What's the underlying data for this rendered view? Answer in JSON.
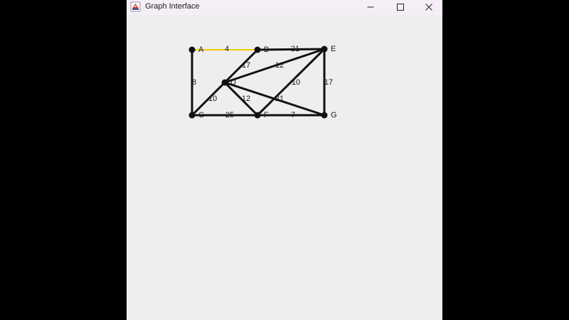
{
  "window": {
    "title": "Graph Interface",
    "icon": "java-cup-icon",
    "controls": [
      "minimize-icon",
      "maximize-icon",
      "close-icon"
    ]
  },
  "colors": {
    "edge": "#111111",
    "highlight": "#f0d000",
    "node": "#111111",
    "background": "#eeedf0",
    "titlebar": "#f6eef7"
  },
  "graph": {
    "nodes": [
      {
        "id": "A",
        "label": "A"
      },
      {
        "id": "B",
        "label": "B"
      },
      {
        "id": "C",
        "label": "C"
      },
      {
        "id": "D",
        "label": "D"
      },
      {
        "id": "E",
        "label": "E"
      },
      {
        "id": "F",
        "label": "F"
      },
      {
        "id": "G",
        "label": "G"
      }
    ],
    "edges": [
      {
        "from": "A",
        "to": "B",
        "weight": "4",
        "highlighted": true
      },
      {
        "from": "B",
        "to": "E",
        "weight": "21",
        "highlighted": false
      },
      {
        "from": "A",
        "to": "C",
        "weight": "8",
        "highlighted": false
      },
      {
        "from": "B",
        "to": "D",
        "weight": "17",
        "highlighted": false
      },
      {
        "from": "D",
        "to": "E",
        "weight": "12",
        "highlighted": false
      },
      {
        "from": "E",
        "to": "F",
        "weight": "10",
        "highlighted": false
      },
      {
        "from": "E",
        "to": "G",
        "weight": "17",
        "highlighted": false
      },
      {
        "from": "C",
        "to": "D",
        "weight": "10",
        "highlighted": false
      },
      {
        "from": "D",
        "to": "F",
        "weight": "12",
        "highlighted": false
      },
      {
        "from": "D",
        "to": "G",
        "weight": "21",
        "highlighted": false
      },
      {
        "from": "C",
        "to": "F",
        "weight": "25",
        "highlighted": false
      },
      {
        "from": "F",
        "to": "G",
        "weight": "7",
        "highlighted": false
      }
    ]
  }
}
